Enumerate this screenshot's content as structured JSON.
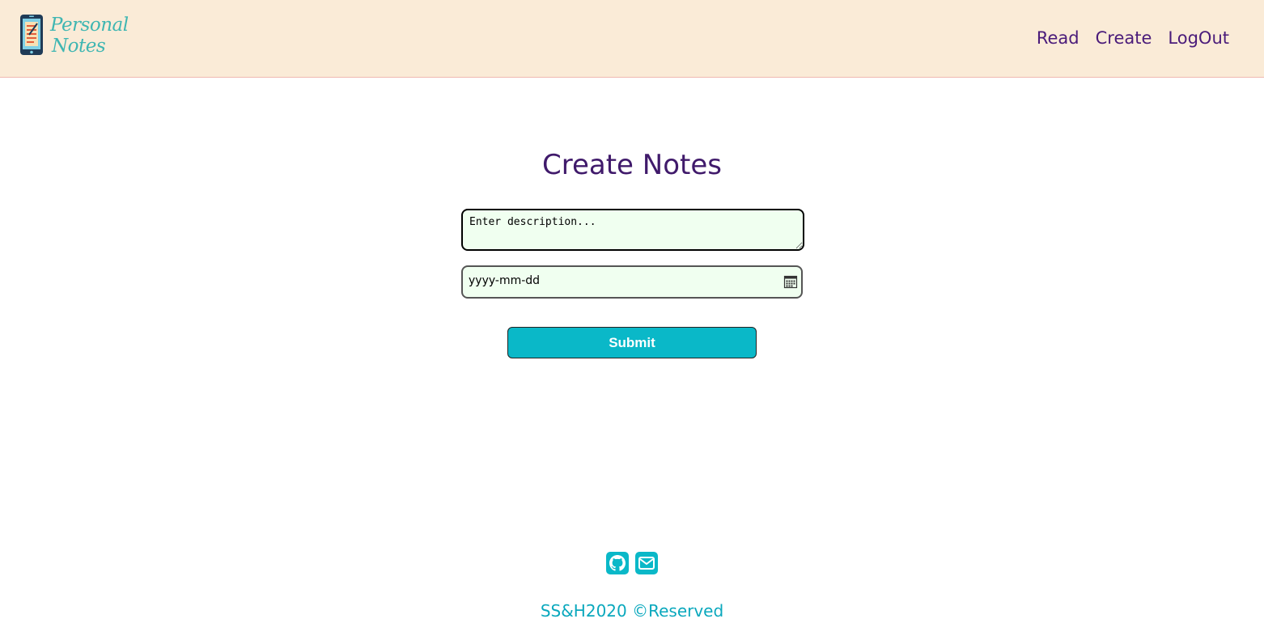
{
  "navbar": {
    "brand": {
      "line1": "Personal",
      "line2": "Notes"
    },
    "links": [
      {
        "label": "Read"
      },
      {
        "label": "Create"
      },
      {
        "label": "LogOut"
      }
    ]
  },
  "form": {
    "title": "Create Notes",
    "description_placeholder": "Enter description...",
    "date_placeholder": "yyyy-mm-dd",
    "submit_label": "Submit"
  },
  "footer": {
    "icons": [
      "github-icon",
      "mail-icon"
    ],
    "text": "SS&H2020 ©Reserved"
  },
  "colors": {
    "navbar_bg": "#faebd7",
    "nav_link": "#4a1b7a",
    "title": "#401a6b",
    "accent": "#0ab8c8",
    "input_bg": "#f0fff0"
  }
}
